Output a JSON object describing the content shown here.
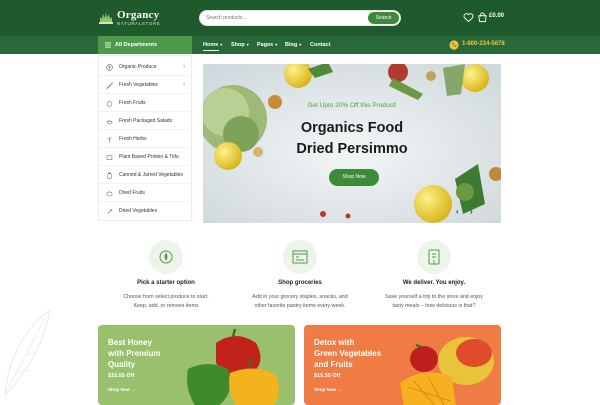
{
  "brand": {
    "name": "Organcy",
    "tagline": "NATURALSTORE"
  },
  "search": {
    "placeholder": "Search products...",
    "button": "Search"
  },
  "cart": {
    "amount": "£0.00"
  },
  "nav": {
    "all_departments": "All Departments",
    "items": [
      {
        "label": "Home",
        "caret": "▾"
      },
      {
        "label": "Shop",
        "caret": "▾"
      },
      {
        "label": "Pages",
        "caret": "▾"
      },
      {
        "label": "Blog",
        "caret": "▾"
      },
      {
        "label": "Contact",
        "caret": ""
      }
    ],
    "phone": "1-800-234-5678"
  },
  "sidebar": {
    "items": [
      {
        "label": "Organic Produce",
        "chevron": "›"
      },
      {
        "label": "Fresh Vegetables",
        "chevron": "›"
      },
      {
        "label": "Fresh Fruits",
        "chevron": ""
      },
      {
        "label": "Fresh Packaged Salads",
        "chevron": ""
      },
      {
        "label": "Fresh Herbs",
        "chevron": ""
      },
      {
        "label": "Plant Based Protein & Tofu",
        "chevron": ""
      },
      {
        "label": "Canned & Jarred Vegetables",
        "chevron": ""
      },
      {
        "label": "Dried Fruits",
        "chevron": ""
      },
      {
        "label": "Dried Vegetables",
        "chevron": ""
      }
    ]
  },
  "hero": {
    "promo": "Get Upto 20% Off this Product!",
    "title_line1": "Organics Food",
    "title_line2": "Dried Persimmo",
    "button": "Shop Now",
    "prev": "‹",
    "next": "›"
  },
  "features": [
    {
      "title": "Pick a starter option",
      "desc1": "Choose from select produce to start.",
      "desc2": "Keep, add, or remove items",
      "icon": "leaf-icon"
    },
    {
      "title": "Shop groceries",
      "desc1": "Add in your grocery staples, snacks, and",
      "desc2": "other favorite pantry items every week.",
      "icon": "shop-icon"
    },
    {
      "title": "We deliver. You enjoy.",
      "desc1": "Save yourself a trip to the store and enjoy",
      "desc2": "tasty meals – how delicious is that?",
      "icon": "delivery-icon"
    }
  ],
  "banners": [
    {
      "title1": "Best Honey",
      "title2": "with Premium",
      "title3": "Quality",
      "price": "$15.55 Off",
      "link": "Shop Now →",
      "color": "#99c06d"
    },
    {
      "title1": "Detox with",
      "title2": "Green Vegetables",
      "title3": "and Fruits",
      "price": "$15.55 Off",
      "link": "Shop Now →",
      "color": "#ee7c44"
    }
  ],
  "colors": {
    "primary_dark": "#1e5a2b",
    "nav": "#28693a",
    "accent_green": "#4d9b4a",
    "phone_yellow": "#f3c23c"
  }
}
